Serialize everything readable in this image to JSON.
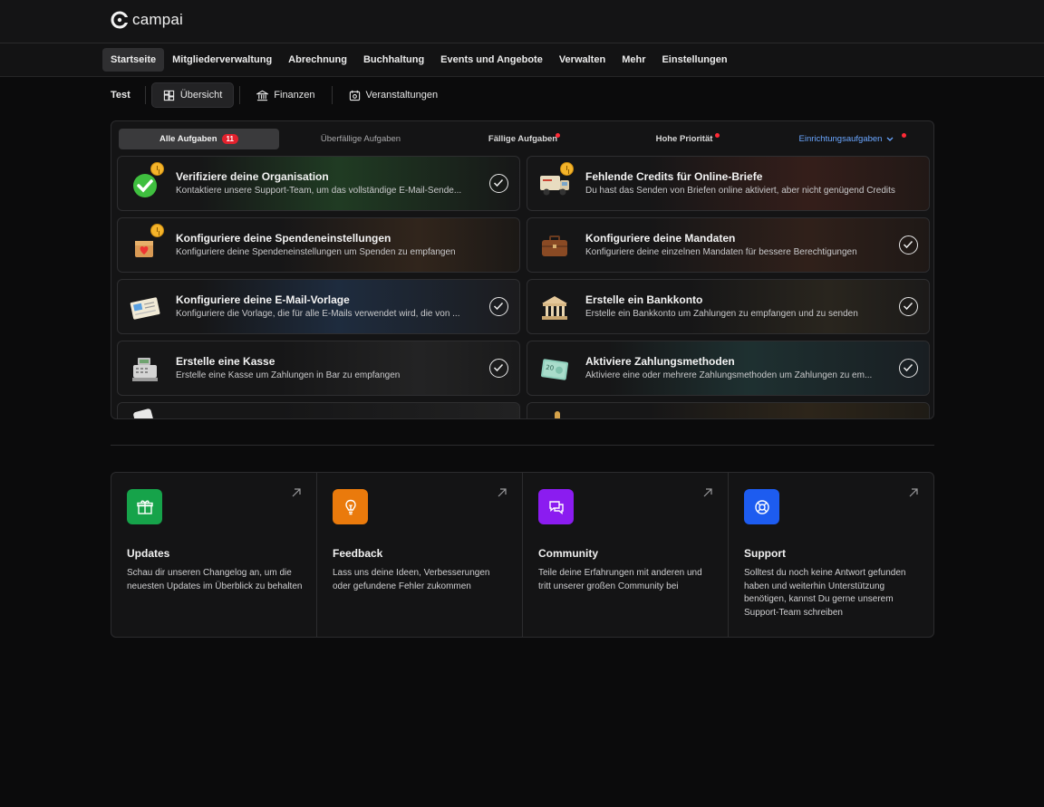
{
  "app": {
    "brand": "campai"
  },
  "main_nav": [
    {
      "label": "Startseite",
      "active": true
    },
    {
      "label": "Mitgliederverwaltung"
    },
    {
      "label": "Abrechnung"
    },
    {
      "label": "Buchhaltung"
    },
    {
      "label": "Events und Angebote"
    },
    {
      "label": "Verwalten"
    },
    {
      "label": "Mehr"
    },
    {
      "label": "Einstellungen"
    }
  ],
  "sub_nav": {
    "org": "Test",
    "items": [
      {
        "label": "Übersicht",
        "icon": "dashboard-icon",
        "active": true
      },
      {
        "label": "Finanzen",
        "icon": "bank-icon"
      },
      {
        "label": "Veranstaltungen",
        "icon": "calendar-icon"
      }
    ]
  },
  "tasks": {
    "tabs": [
      {
        "label": "Alle Aufgaben",
        "badge": "11",
        "active": true
      },
      {
        "label": "Überfällige Aufgaben"
      },
      {
        "label": "Fällige Aufgaben",
        "dot": true
      },
      {
        "label": "Hohe Priorität",
        "dot": true
      },
      {
        "label": "Einrichtungsaufgaben",
        "dot": true,
        "dropdown": true
      }
    ],
    "cards": [
      {
        "title": "Verifiziere deine Organisation",
        "desc": "Kontaktiere unsere Support-Team, um das vollständige E-Mail-Sende...",
        "icon": "checkmark-icon",
        "clock": true,
        "check": true,
        "glow": "#1f5a2a"
      },
      {
        "title": "Fehlende Credits für Online-Briefe",
        "desc": "Du hast das Senden von Briefen online aktiviert, aber nicht genügend Credits",
        "icon": "mail-truck-icon",
        "clock": true,
        "check": false,
        "glow": "#5a2a1a"
      },
      {
        "title": "Konfiguriere deine Spendeneinstellungen",
        "desc": "Konfiguriere deine Spendeneinstellungen um Spenden zu empfangen",
        "icon": "donation-box-icon",
        "clock": true,
        "check": false,
        "glow": "#5a3a1a"
      },
      {
        "title": "Konfiguriere deine Mandaten",
        "desc": "Konfiguriere deine einzelnen Mandaten für bessere Berechtigungen",
        "icon": "briefcase-icon",
        "clock": false,
        "check": true,
        "glow": "#4a2a1a"
      },
      {
        "title": "Konfiguriere deine E-Mail-Vorlage",
        "desc": "Konfiguriere die Vorlage, die für alle E-Mails verwendet wird, die von ...",
        "icon": "letter-icon",
        "clock": false,
        "check": true,
        "glow": "#1f3a5a"
      },
      {
        "title": "Erstelle ein Bankkonto",
        "desc": "Erstelle ein Bankkonto um Zahlungen zu empfangen und zu senden",
        "icon": "bank-building-icon",
        "clock": false,
        "check": true,
        "glow": "#3a3020"
      },
      {
        "title": "Erstelle eine Kasse",
        "desc": "Erstelle eine Kasse um Zahlungen in Bar zu empfangen",
        "icon": "cash-register-icon",
        "clock": false,
        "check": true,
        "glow": "#3a3a3a"
      },
      {
        "title": "Aktiviere Zahlungsmethoden",
        "desc": "Aktiviere eine oder mehrere Zahlungsmethoden um Zahlungen zu em...",
        "icon": "banknote-icon",
        "clock": false,
        "check": true,
        "glow": "#1f4a4a"
      }
    ]
  },
  "help_cards": [
    {
      "title": "Updates",
      "desc": "Schau dir unseren Changelog an, um die neuesten Updates im Überblick zu behalten",
      "icon": "gift-icon",
      "color": "#16a34a"
    },
    {
      "title": "Feedback",
      "desc": "Lass uns deine Ideen, Verbesserungen oder gefundene Fehler zukommen",
      "icon": "lightbulb-icon",
      "color": "#ea7a0c"
    },
    {
      "title": "Community",
      "desc": "Teile deine Erfahrungen mit anderen und tritt unserer großen Community bei",
      "icon": "chat-icon",
      "color": "#8b1cf0"
    },
    {
      "title": "Support",
      "desc": "Solltest du noch keine Antwort gefunden haben und weiterhin Unterstützung benötigen, kannst Du gerne unserem Support-Team schreiben",
      "icon": "lifebuoy-icon",
      "color": "#1d5cf0"
    }
  ]
}
